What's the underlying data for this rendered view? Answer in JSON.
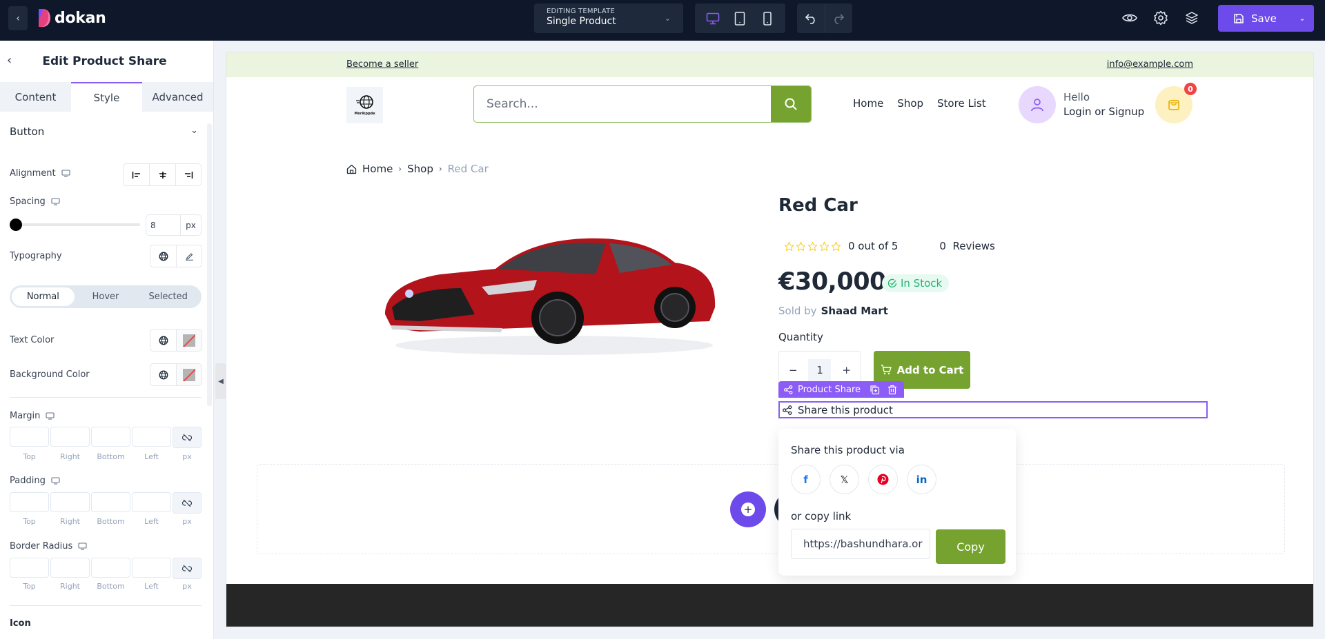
{
  "topbar": {
    "back_icon": "chevron-left-icon",
    "logo_text": "dokan",
    "template_label": "EDITING TEMPLATE",
    "template_name": "Single Product",
    "devices": [
      "desktop",
      "tablet",
      "mobile"
    ],
    "active_device": "desktop",
    "save_label": "Save",
    "accent": "#6d4aea"
  },
  "panel": {
    "title": "Edit Product Share",
    "tabs": [
      "Content",
      "Style",
      "Advanced"
    ],
    "active_tab": "Style",
    "section": "Button",
    "alignment_label": "Alignment",
    "spacing_label": "Spacing",
    "spacing_value": "8",
    "spacing_unit": "px",
    "typography_label": "Typography",
    "states": [
      "Normal",
      "Hover",
      "Selected"
    ],
    "active_state": "Normal",
    "text_color_label": "Text Color",
    "bg_color_label": "Background Color",
    "margin_label": "Margin",
    "padding_label": "Padding",
    "radius_label": "Border Radius",
    "dim_labels": [
      "Top",
      "Right",
      "Bottom",
      "Left",
      "px"
    ],
    "icon_section": "Icon"
  },
  "site": {
    "become_seller": "Become a seller",
    "email": "info@example.com",
    "logo_text": "Morikppde",
    "search_placeholder": "Search...",
    "nav": [
      "Home",
      "Shop",
      "Store List"
    ],
    "hello": "Hello",
    "login": "Login or Signup",
    "cart_count": "0"
  },
  "breadcrumb": [
    "Home",
    "Shop",
    "Red Car"
  ],
  "product": {
    "title": "Red Car",
    "rating_text": "0 out of 5",
    "rating_value": 0,
    "rating_max": 5,
    "reviews_count": "0",
    "reviews_label": "Reviews",
    "price": "€30,000",
    "stock": "In Stock",
    "sold_by_label": "Sold by",
    "vendor": "Shaad Mart",
    "quantity_label": "Quantity",
    "quantity": "1",
    "add_to_cart": "Add to Cart"
  },
  "element_toolbar": {
    "label": "Product Share"
  },
  "share": {
    "text": "Share this product",
    "via": "Share this product via",
    "networks": [
      {
        "name": "facebook",
        "glyph": "f",
        "color": "#1877f2"
      },
      {
        "name": "x",
        "glyph": "𝕏",
        "color": "#111111"
      },
      {
        "name": "pinterest",
        "glyph": "P",
        "color": "#e60023"
      },
      {
        "name": "linkedin",
        "glyph": "in",
        "color": "#0a66c2"
      }
    ],
    "copy_label": "or copy link",
    "link_value": "https://bashundhara.or",
    "copy_button": "Copy"
  }
}
